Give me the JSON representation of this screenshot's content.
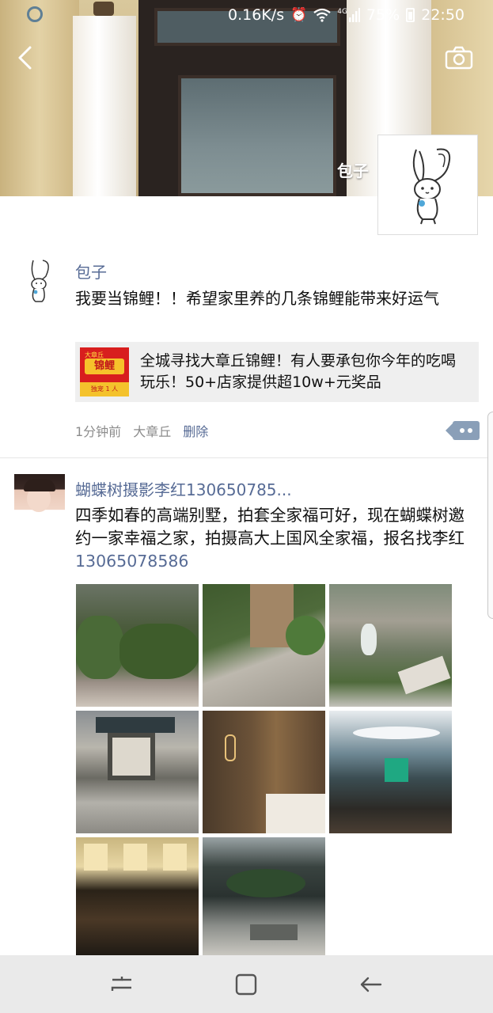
{
  "status_bar": {
    "speed": "0.16K/s",
    "network": "4G",
    "battery": "75%",
    "time": "22:50",
    "icons": [
      "sync-icon",
      "alarm-icon",
      "wifi-icon",
      "signal-icon",
      "battery-icon"
    ]
  },
  "header": {
    "back_icon": "chevron-left-icon",
    "camera_icon": "camera-icon",
    "profile_name": "包子"
  },
  "posts": [
    {
      "author": "包子",
      "text": "我要当锦鲤！！希望家里养的几条锦鲤能带来好运气",
      "shared_link": {
        "thumb_top": "大章丘",
        "thumb_title": "锦鲤",
        "thumb_bottom": "独宠 1 人",
        "title": "全城寻找大章丘锦鲤！有人要承包你今年的吃喝玩乐！50+店家提供超10w+元奖品"
      },
      "time": "1分钟前",
      "location": "大章丘",
      "delete_label": "删除"
    },
    {
      "author": "蝴蝶树摄影李红130650785...",
      "text_prefix": "四季如春的高端别墅，拍套全家福可好，现在蝴蝶树邀约一家幸福之家，拍摄高大上国风全家福，报名找李红",
      "phone": "13065078586",
      "photo_count": 8
    }
  ],
  "nav_bar": {
    "icons": [
      "recent-apps-icon",
      "home-icon",
      "back-icon"
    ]
  },
  "colors": {
    "link": "#576b95",
    "text": "#111111",
    "meta": "#8c8c8c",
    "card_bg": "#efefef"
  }
}
